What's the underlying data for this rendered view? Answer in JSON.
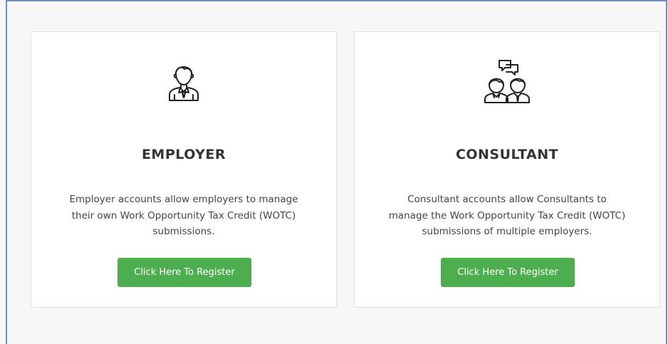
{
  "cards": [
    {
      "icon": "employer-person-icon",
      "title": "EMPLOYER",
      "desc_lines": [
        "Employer accounts allow employers to manage",
        "their own Work Opportunity Tax Credit (WOTC)",
        "submissions."
      ],
      "button_label": "Click Here To Register"
    },
    {
      "icon": "consultant-people-chat-icon",
      "title": "CONSULTANT",
      "desc_lines": [
        "Consultant accounts allow Consultants to",
        "manage the Work Opportunity Tax Credit (WOTC)",
        "submissions of multiple employers."
      ],
      "button_label": "Click Here To Register"
    }
  ],
  "colors": {
    "button": "#4cae4f",
    "frame_border": "#6e8fc0",
    "background": "#f7f7f7"
  }
}
